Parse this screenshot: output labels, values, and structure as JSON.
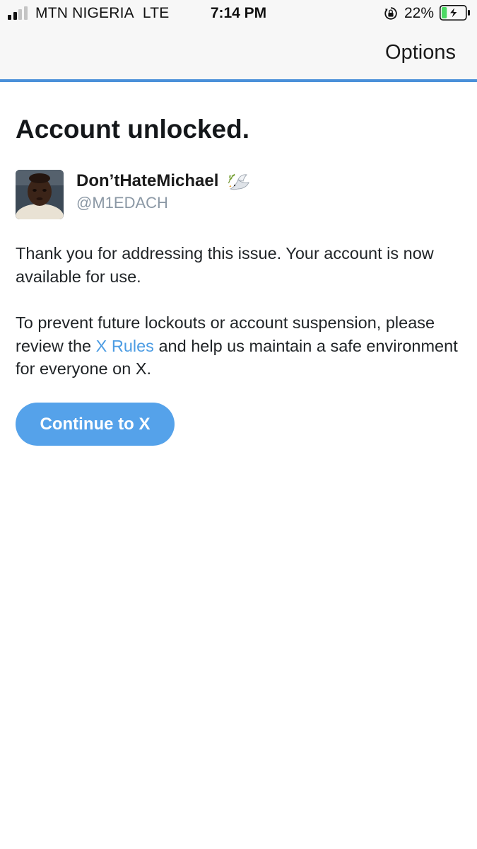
{
  "status_bar": {
    "carrier": "MTN NIGERIA",
    "network": "LTE",
    "time": "7:14 PM",
    "battery_percent_label": "22%",
    "battery_level": 0.22,
    "signal_bars_active": 2,
    "signal_bars_total": 4,
    "icons": [
      "cellular-signal-icon",
      "rotation-lock-icon",
      "battery-charging-icon"
    ]
  },
  "nav": {
    "options_label": "Options"
  },
  "progress": {
    "value": 1.0,
    "color": "#4a90d9"
  },
  "page": {
    "title": "Account unlocked.",
    "user": {
      "display_name": "Don’tHateMichael",
      "emoji_icon": "dove-with-olive-branch-icon",
      "handle": "@M1EDACH"
    },
    "message_1": "Thank you for addressing this issue. Your account is now available for use.",
    "message_2_before": "To prevent future lockouts or account suspension, please review the ",
    "rules_link": "X Rules",
    "message_2_after": " and help us maintain a safe environment for everyone on X.",
    "continue_button": "Continue to X"
  },
  "colors": {
    "accent": "#55a2ea",
    "link": "#4c9ce3",
    "battery_fill": "#4cd964",
    "text": "#14171a",
    "handle_text": "#8b98a5"
  }
}
